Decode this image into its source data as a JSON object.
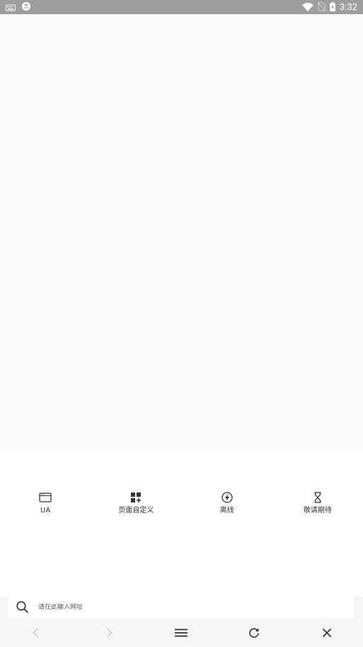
{
  "status_bar": {
    "time": "3:32",
    "left_icons": [
      "keyboard-icon",
      "steering-wheel-icon"
    ],
    "right_icons": [
      "wifi-icon",
      "no-sim-icon",
      "battery-charging-icon"
    ]
  },
  "tools": [
    {
      "label": "UA",
      "icon": "browser-window-icon"
    },
    {
      "label": "页面自定义",
      "icon": "dashboard-add-icon"
    },
    {
      "label": "离线",
      "icon": "bolt-circle-icon"
    },
    {
      "label": "敬请期待",
      "icon": "hourglass-icon"
    }
  ],
  "address_bar": {
    "placeholder": "请在此输入网址",
    "value": ""
  },
  "nav": {
    "back": "chevron-left-icon",
    "forward": "chevron-right-icon",
    "menu": "menu-icon",
    "refresh": "refresh-icon",
    "close": "close-icon"
  },
  "colors": {
    "status_bar": "#9e9e9e",
    "content_bg": "#fafafa",
    "panel_bg": "#ffffff",
    "nav_bg": "#f5f5f5",
    "icon_dark": "#333333",
    "icon_disabled": "#c8c8c8"
  }
}
